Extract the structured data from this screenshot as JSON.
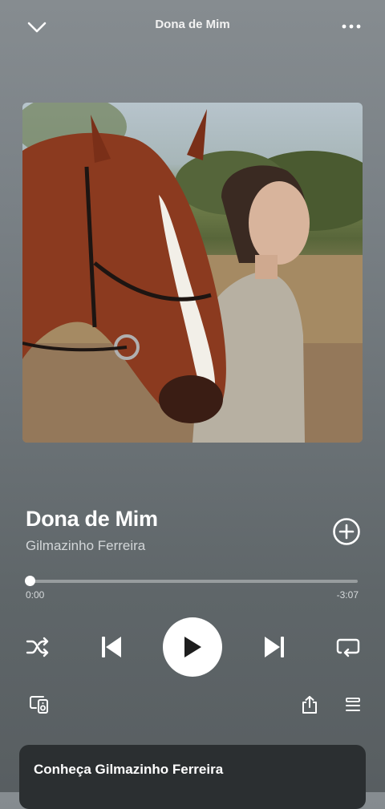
{
  "header": {
    "title": "Dona de Mim",
    "collapse_icon": "chevron-down-icon",
    "more_icon": "more-horizontal-icon"
  },
  "track": {
    "title": "Dona de Mim",
    "artist": "Gilmazinho Ferreira",
    "add_icon": "add-circle-icon"
  },
  "progress": {
    "elapsed": "0:00",
    "remaining": "-3:07",
    "fraction": 0.0
  },
  "controls": {
    "shuffle_icon": "shuffle-icon",
    "previous_icon": "skip-previous-icon",
    "play_icon": "play-icon",
    "next_icon": "skip-next-icon",
    "repeat_icon": "repeat-icon"
  },
  "bottom_bar": {
    "devices_icon": "connect-device-icon",
    "share_icon": "share-icon",
    "queue_icon": "queue-icon"
  },
  "artist_card": {
    "title": "Conheça Gilmazinho Ferreira"
  },
  "colors": {
    "background_top": "#868c90",
    "background_bottom": "#585e61",
    "card": "#2b2f31"
  }
}
